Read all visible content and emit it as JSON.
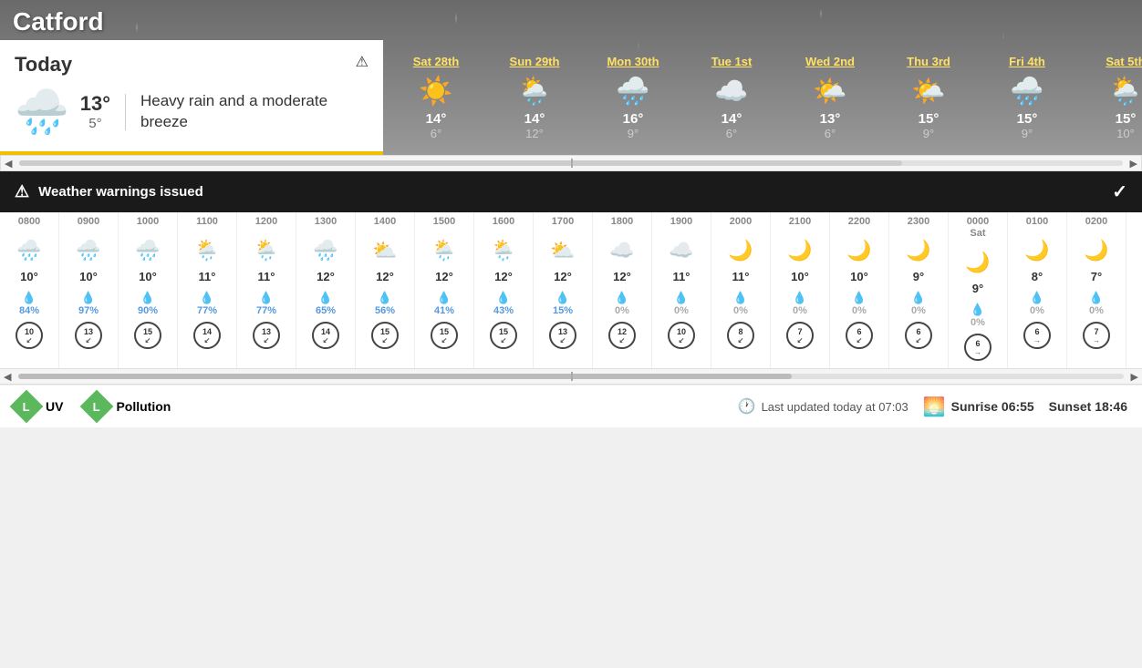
{
  "city": "Catford",
  "today": {
    "label": "Today",
    "high": "13°",
    "low": "5°",
    "description": "Heavy rain and a moderate breeze",
    "icon": "🌧️"
  },
  "warning": {
    "text": "Weather warnings issued"
  },
  "forecast": [
    {
      "label": "Sat 28th",
      "icon": "☀️",
      "high": "14°",
      "low": "6°"
    },
    {
      "label": "Sun 29th",
      "icon": "🌦️",
      "high": "14°",
      "low": "12°"
    },
    {
      "label": "Mon 30th",
      "icon": "🌧️",
      "high": "16°",
      "low": "9°"
    },
    {
      "label": "Tue 1st",
      "icon": "☁️",
      "high": "14°",
      "low": "6°"
    },
    {
      "label": "Wed 2nd",
      "icon": "🌤️",
      "high": "13°",
      "low": "6°"
    },
    {
      "label": "Thu 3rd",
      "icon": "🌤️",
      "high": "15°",
      "low": "9°"
    },
    {
      "label": "Fri 4th",
      "icon": "🌧️",
      "high": "15°",
      "low": "9°"
    },
    {
      "label": "Sat 5th",
      "icon": "🌦️",
      "high": "15°",
      "low": "10°"
    }
  ],
  "hourly": [
    {
      "time": "0800",
      "icon": "🌧️",
      "temp": "10°",
      "rain_icon": "💧",
      "rain_pct": "84%",
      "wind": "10",
      "wind_dir": "↙"
    },
    {
      "time": "0900",
      "icon": "🌧️",
      "temp": "10°",
      "rain_icon": "💧",
      "rain_pct": "97%",
      "wind": "13",
      "wind_dir": "↙"
    },
    {
      "time": "1000",
      "icon": "🌧️",
      "temp": "10°",
      "rain_icon": "💧",
      "rain_pct": "90%",
      "wind": "15",
      "wind_dir": "↙"
    },
    {
      "time": "1100",
      "icon": "🌦️",
      "temp": "11°",
      "rain_icon": "💧",
      "rain_pct": "77%",
      "wind": "14",
      "wind_dir": "↙"
    },
    {
      "time": "1200",
      "icon": "🌦️",
      "temp": "11°",
      "rain_icon": "💧",
      "rain_pct": "77%",
      "wind": "13",
      "wind_dir": "↙"
    },
    {
      "time": "1300",
      "icon": "🌧️",
      "temp": "12°",
      "rain_icon": "💧",
      "rain_pct": "65%",
      "wind": "14",
      "wind_dir": "↙"
    },
    {
      "time": "1400",
      "icon": "⛅",
      "temp": "12°",
      "rain_icon": "💧",
      "rain_pct": "56%",
      "wind": "15",
      "wind_dir": "↙"
    },
    {
      "time": "1500",
      "icon": "🌦️",
      "temp": "12°",
      "rain_icon": "💧",
      "rain_pct": "41%",
      "wind": "15",
      "wind_dir": "↙"
    },
    {
      "time": "1600",
      "icon": "🌦️",
      "temp": "12°",
      "rain_icon": "💧",
      "rain_pct": "43%",
      "wind": "15",
      "wind_dir": "↙"
    },
    {
      "time": "1700",
      "icon": "⛅",
      "temp": "12°",
      "rain_icon": "💧",
      "rain_pct": "15%",
      "wind": "13",
      "wind_dir": "↙"
    },
    {
      "time": "1800",
      "icon": "☁️",
      "temp": "12°",
      "rain_icon": "💧",
      "rain_pct": "0%",
      "wind": "12",
      "wind_dir": "↙"
    },
    {
      "time": "1900",
      "icon": "☁️",
      "temp": "11°",
      "rain_icon": "💧",
      "rain_pct": "0%",
      "wind": "10",
      "wind_dir": "↙"
    },
    {
      "time": "2000",
      "icon": "🌙",
      "temp": "11°",
      "rain_icon": "💧",
      "rain_pct": "0%",
      "wind": "8",
      "wind_dir": "↙"
    },
    {
      "time": "2100",
      "icon": "🌙",
      "temp": "10°",
      "rain_icon": "💧",
      "rain_pct": "0%",
      "wind": "7",
      "wind_dir": "↙"
    },
    {
      "time": "2200",
      "icon": "🌙",
      "temp": "10°",
      "rain_icon": "💧",
      "rain_pct": "0%",
      "wind": "6",
      "wind_dir": "↙"
    },
    {
      "time": "2300",
      "icon": "🌙",
      "temp": "9°",
      "rain_icon": "💧",
      "rain_pct": "0%",
      "wind": "6",
      "wind_dir": "↙"
    },
    {
      "time": "0000\nSat",
      "icon": "🌙",
      "temp": "9°",
      "rain_icon": "💧",
      "rain_pct": "0%",
      "wind": "6",
      "wind_dir": "→"
    },
    {
      "time": "0100",
      "icon": "🌙",
      "temp": "8°",
      "rain_icon": "💧",
      "rain_pct": "0%",
      "wind": "6",
      "wind_dir": "→"
    },
    {
      "time": "0200",
      "icon": "🌙",
      "temp": "7°",
      "rain_icon": "💧",
      "rain_pct": "0%",
      "wind": "7",
      "wind_dir": "→"
    }
  ],
  "footer": {
    "uv_label": "UV",
    "uv_badge": "L",
    "pollution_label": "Pollution",
    "pollution_badge": "L",
    "last_updated": "Last updated today at 07:03",
    "sunrise": "Sunrise 06:55",
    "sunset": "Sunset 18:46"
  }
}
